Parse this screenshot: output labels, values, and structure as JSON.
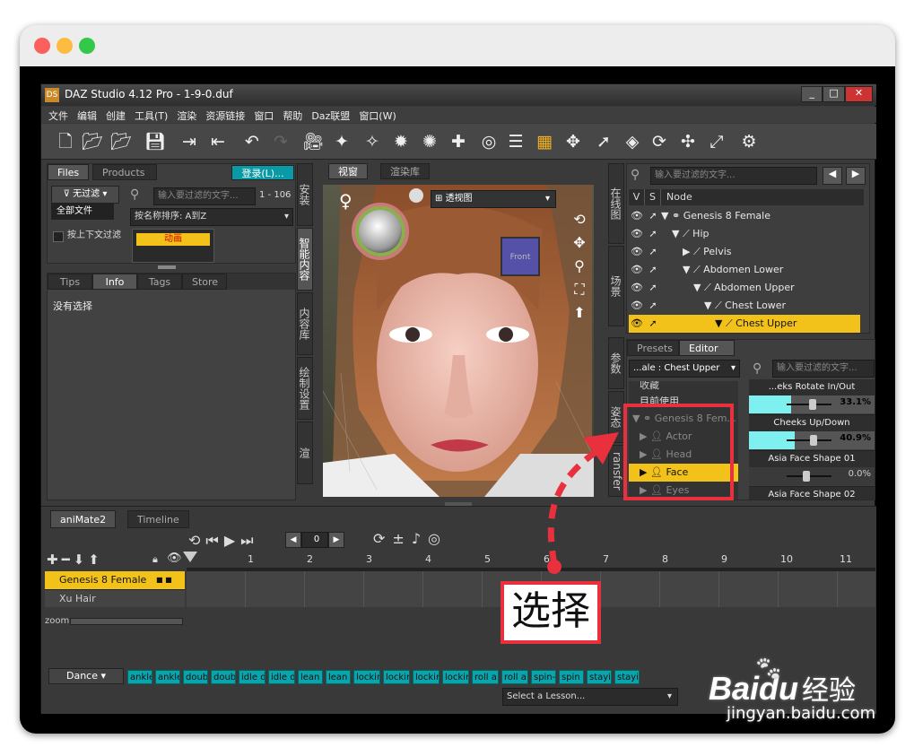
{
  "window": {
    "title": "DAZ Studio 4.12 Pro - 1-9-0.duf",
    "app_badge": "DS"
  },
  "menu": [
    "文件",
    "编辑",
    "创建",
    "工具(T)",
    "渲染",
    "资源链接",
    "窗口",
    "帮助",
    "Daz联盟",
    "窗口(W)"
  ],
  "left_panel": {
    "tabs": [
      "Files",
      "Products"
    ],
    "login": "登录(L)...",
    "filter_btn": "无过滤",
    "all_files": "全部文件",
    "search_placeholder": "输入要过滤的文字...",
    "count": "1 - 106",
    "sort": "按名称排序: A到Z",
    "context_filter": "按上下文过滤",
    "thumb_label": "动画",
    "info_tabs": [
      "Tips",
      "Info",
      "Tags",
      "Store"
    ],
    "info_text": "没有选择",
    "side_tabs": [
      "安装",
      "智能内容",
      "内容库",
      "绘制设置",
      "渲"
    ]
  },
  "viewport": {
    "tabs": [
      "视窗",
      "渲染库"
    ],
    "view_mode": "透视图",
    "cube_label": "Front"
  },
  "scene": {
    "side_tabs": [
      "在线图",
      "场景"
    ],
    "search_placeholder": "输入要过滤的文字...",
    "col_v": "V",
    "col_s": "S",
    "col_node": "Node",
    "nodes": [
      "Genesis 8 Female",
      "Hip",
      "Pelvis",
      "Abdomen Lower",
      "Abdomen Upper",
      "Chest Lower",
      "Chest Upper"
    ]
  },
  "params": {
    "side_tabs": [
      "参数",
      "姿态",
      "ransfer"
    ],
    "tabs": [
      "Presets",
      "Editor"
    ],
    "selector": "...ale : Chest Upper",
    "search_placeholder": "输入要过滤的文字...",
    "list_top": [
      "收藏",
      "目前使用"
    ],
    "tree": [
      "Genesis 8 Fem...",
      "Actor",
      "Head",
      "Face",
      "Eyes"
    ],
    "sliders": [
      {
        "name": "...eks Rotate In/Out",
        "value": "33.1%",
        "fill": 0.33,
        "hl": true
      },
      {
        "name": "Cheeks Up/Down",
        "value": "40.9%",
        "fill": 0.41,
        "hl": true
      },
      {
        "name": "Asia Face Shape 01",
        "value": "0.0%",
        "fill": 0,
        "hl": false
      },
      {
        "name": "Asia Face Shape 02",
        "value": "",
        "fill": 0,
        "hl": false
      }
    ]
  },
  "timeline": {
    "tabs": [
      "aniMate2",
      "Timeline"
    ],
    "frame": "0",
    "ticks": [
      "1",
      "2",
      "3",
      "4",
      "5",
      "6",
      "7",
      "8",
      "9",
      "10",
      "11"
    ],
    "tracks": [
      "Genesis 8 Female",
      "Xu Hair"
    ],
    "zoom_label": "zoom",
    "category": "Dance",
    "clips": [
      "ankle",
      "ankle",
      "doub",
      "doub",
      "idle d",
      "idle d",
      "lean",
      "lean",
      "lockir",
      "lockir",
      "lockir",
      "lockir",
      "roll a",
      "roll a",
      "spin-",
      "spin",
      "stayi",
      "stayi"
    ],
    "lesson": "Select a Lesson..."
  },
  "annotation": {
    "label": "选择",
    "color": "#e8313c"
  },
  "watermark": {
    "brand": "Bai",
    "brand2": "du",
    "cn": "经验",
    "url": "jingyan.baidu.com"
  }
}
